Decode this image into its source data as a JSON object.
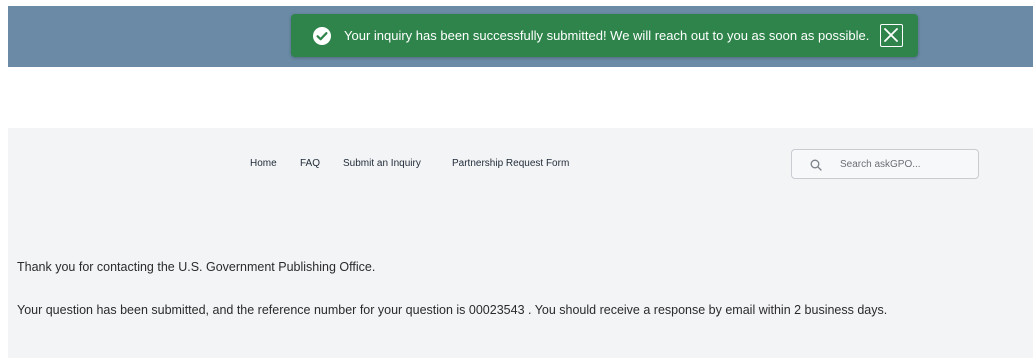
{
  "toast": {
    "message": "Your inquiry has been successfully submitted! We will reach out to you as soon as possible.",
    "status_icon": "check-circle-icon",
    "close_icon": "close-icon",
    "color": "#2e844a"
  },
  "banner": {
    "color": "#6a8aa6"
  },
  "nav": {
    "items": [
      {
        "label": "Home"
      },
      {
        "label": "FAQ"
      },
      {
        "label": "Submit an Inquiry"
      },
      {
        "label": "Partnership Request Form"
      }
    ]
  },
  "search": {
    "placeholder": "Search askGPO...",
    "icon": "search-icon"
  },
  "main": {
    "thankyou_text": "Thank you for contacting the U.S. Government Publishing Office.",
    "confirmation_text": "Your question has been submitted, and the reference number for your question is 00023543 . You should receive a response by email within 2 business days."
  }
}
